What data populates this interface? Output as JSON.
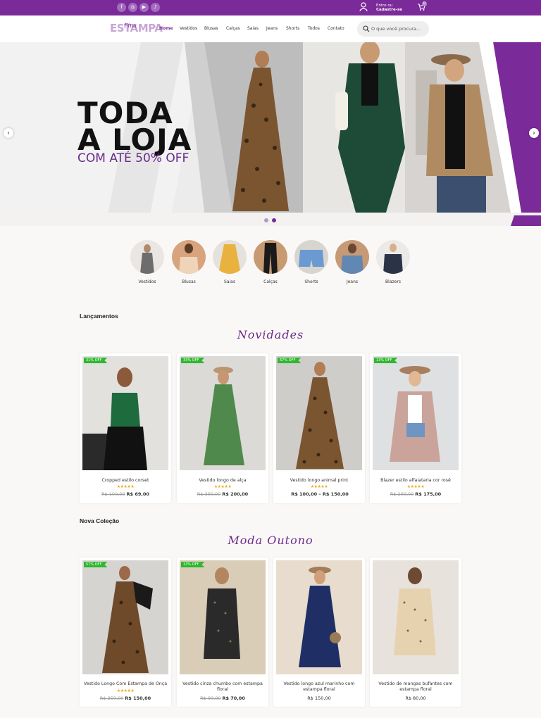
{
  "topbar": {
    "social_icons": [
      "facebook-icon",
      "instagram-icon",
      "youtube-icon",
      "tiktok-icon"
    ],
    "login_line1": "Entre ou",
    "login_line2": "Cadastre-se",
    "cart_count": "0"
  },
  "header": {
    "logo": "ESTAMPA",
    "logo_script": "Fina",
    "nav": [
      "Home",
      "Vestidos",
      "Blusas",
      "Calças",
      "Saias",
      "Jeans",
      "Shorts",
      "Todos",
      "Contato"
    ],
    "search_placeholder": "O que você procura..."
  },
  "hero": {
    "title_line1": "TODA",
    "title_line2": "A LOJA",
    "subtitle": "COM ATÉ 50% OFF",
    "prev": "‹",
    "next": "›"
  },
  "categories": [
    "Vestidos",
    "Blusas",
    "Saias",
    "Calças",
    "Shorts",
    "Jeans",
    "Blazers"
  ],
  "section1": {
    "label": "Lançamentos",
    "script": "Novidades",
    "products": [
      {
        "badge": "31% OFF",
        "name": "Cropped estilo corset",
        "old": "R$ 100,00",
        "new": "R$ 69,00",
        "stars": "★★★★★"
      },
      {
        "badge": "33% OFF",
        "name": "Vestido longo de alça",
        "old": "R$ 300,00",
        "new": "R$ 200,00",
        "stars": "★★★★★"
      },
      {
        "badge": "67% OFF",
        "name": "Vestido longo animal print",
        "old": "",
        "new": "R$ 100,00 – R$ 150,00",
        "stars": "★★★★★"
      },
      {
        "badge": "13% OFF",
        "name": "Blazer estilo alfaiataria cor rosê",
        "old": "R$ 200,00",
        "new": "R$ 175,00",
        "stars": "★★★★★"
      }
    ]
  },
  "section2": {
    "label": "Nova Coleção",
    "script": "Moda Outono",
    "products": [
      {
        "badge": "57% OFF",
        "name": "Vestido Longo Com Estampa de Onça",
        "old": "R$ 350,00",
        "new": "R$ 150,00",
        "stars": "★★★★★"
      },
      {
        "badge": "13% OFF",
        "name": "Vestido cinza chumbo com estampa floral",
        "old": "R$ 90,00",
        "new": "R$ 70,00",
        "stars": ""
      },
      {
        "badge": "",
        "name": "Vestido longo azul marinho com estampa floral",
        "old": "",
        "new": "R$ 150,00",
        "stars": ""
      },
      {
        "badge": "",
        "name": "Vestido de mangas bufantes com estampa floral",
        "old": "",
        "new": "R$ 80,00",
        "stars": ""
      }
    ]
  },
  "colors": {
    "brand": "#7b2a99",
    "badge": "#2eb82e",
    "stars": "#f0a80f"
  }
}
